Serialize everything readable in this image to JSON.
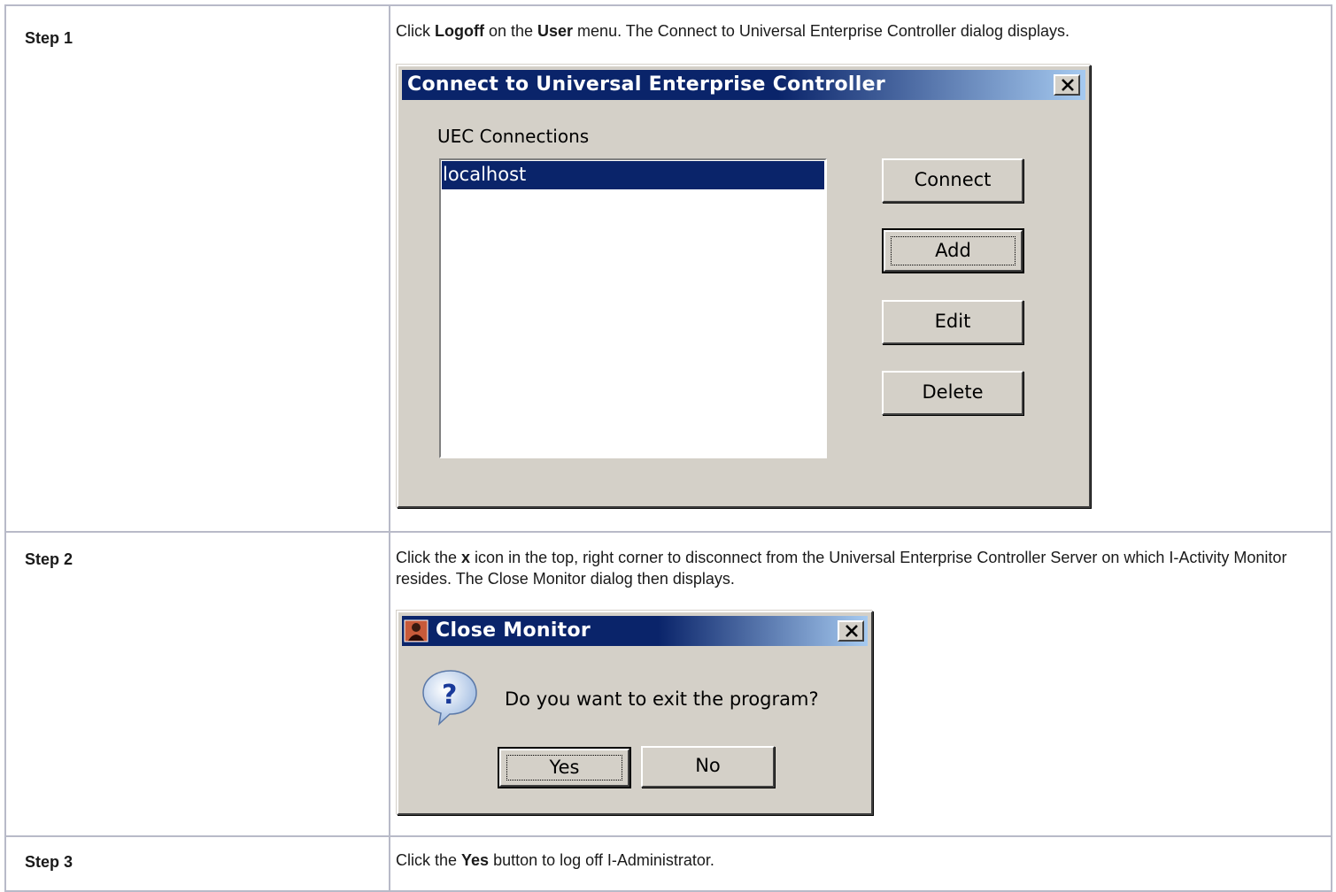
{
  "steps": [
    {
      "label": "Step 1",
      "desc": [
        {
          "t": "Click "
        },
        {
          "b": "Logoff"
        },
        {
          "t": " on the "
        },
        {
          "b": "User"
        },
        {
          "t": " menu. The Connect to Universal Enterprise Controller dialog displays."
        }
      ]
    },
    {
      "label": "Step 2",
      "desc": [
        {
          "t": "Click the "
        },
        {
          "b": "x"
        },
        {
          "t": " icon in the top, right corner to disconnect from the Universal Enterprise Controller Server on which I-Activity Monitor resides. The Close Monitor dialog then displays."
        }
      ]
    },
    {
      "label": "Step 3",
      "desc": [
        {
          "t": "Click the "
        },
        {
          "b": "Yes"
        },
        {
          "t": " button to log off I-Administrator."
        }
      ]
    }
  ],
  "connect_dialog": {
    "title": "Connect to Universal Enterprise Controller",
    "group_label": "UEC Connections",
    "connections": [
      "localhost"
    ],
    "selected_connection": "localhost",
    "buttons": {
      "connect": "Connect",
      "add": "Add",
      "edit": "Edit",
      "delete": "Delete"
    },
    "title_color": "#0a246a",
    "selection_color": "#0a246a"
  },
  "close_dialog": {
    "title": "Close Monitor",
    "message": "Do you want to exit the program?",
    "buttons": {
      "yes": "Yes",
      "no": "No"
    },
    "icon": "question-icon"
  }
}
